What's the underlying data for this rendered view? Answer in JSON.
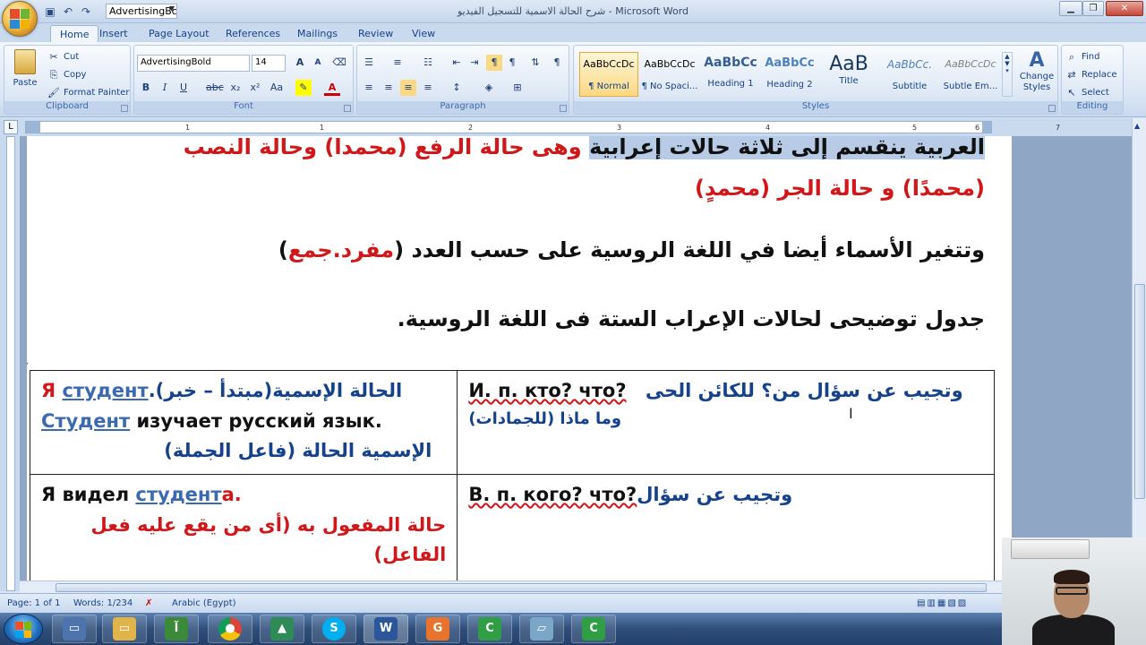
{
  "titlebar": {
    "window_title": "شرح الحالة الاسمية للتسجيل الفيديو - Microsoft Word",
    "font_combo_value": "AdvertisingBc"
  },
  "tabs": [
    "Home",
    "Insert",
    "Page Layout",
    "References",
    "Mailings",
    "Review",
    "View"
  ],
  "active_tab": "Home",
  "ribbon": {
    "clipboard": {
      "label": "Clipboard",
      "paste": "Paste",
      "cut": "Cut",
      "copy": "Copy",
      "format_painter": "Format Painter"
    },
    "font": {
      "label": "Font",
      "font_name": "AdvertisingBold",
      "font_size": "14"
    },
    "paragraph": {
      "label": "Paragraph"
    },
    "styles": {
      "label": "Styles",
      "items": [
        {
          "preview": "AaBbCcDc",
          "name": "¶ Normal"
        },
        {
          "preview": "AaBbCcDc",
          "name": "¶ No Spaci..."
        },
        {
          "preview": "AaBbCc",
          "name": "Heading 1"
        },
        {
          "preview": "AaBbCc",
          "name": "Heading 2"
        },
        {
          "preview": "AaB",
          "name": "Title"
        },
        {
          "preview": "AaBbCc.",
          "name": "Subtitle"
        },
        {
          "preview": "AaBbCcDc",
          "name": "Subtle Em..."
        }
      ],
      "change_styles": "Change Styles"
    },
    "editing": {
      "label": "Editing",
      "find": "Find",
      "replace": "Replace",
      "select": "Select"
    }
  },
  "ruler": {
    "numbers": [
      "1",
      "1",
      "2",
      "3",
      "4",
      "5",
      "6",
      "7"
    ]
  },
  "document": {
    "line1_black": "العربية ينقسم إلى ثلاثة حالات إعرابية",
    "line1_red": "وهى حالة الرفع (محمدا) وحالة النصب",
    "line2_red": "(محمدًا) و حالة الجر (محمدٍ)",
    "line3_black": "وتتغير الأسماء أيضا في اللغة الروسية على حسب العدد (",
    "line3_red": "مفرد.جمع",
    "line3_close": ")",
    "line4": "جدول توضيحى لحالات الإعراب الستة فى اللغة الروسية.",
    "table": {
      "row1_left_ru1_prefix": "Я",
      "row1_left_ru1_link": "студент",
      "row1_left_ar1": ".(مبتدأ – خبر)الحالة الإسمية",
      "row1_left_ru2_link": "Студент",
      "row1_left_ru2_rest": "изучает русский язык.",
      "row1_left_ar2": "الإسمية الحالة (فاعل الجملة)",
      "row1_right_ru": "И. п. кто? что?",
      "row1_right_ar1": "وتجيب عن سؤال من؟ للكائن الحى",
      "row1_right_ar2": "وما ماذا (للجمادات)",
      "row2_left_ru_prefix": "Я видел",
      "row2_left_ru_link": "студент",
      "row2_left_ru_suffix": "а.",
      "row2_left_ar1": "حالة المفعول به (أى من يقع عليه فعل",
      "row2_left_ar2": "الفاعل)",
      "row2_right_ru": "В. п. кого? что?",
      "row2_right_ar": "وتجيب عن سؤال"
    }
  },
  "statusbar": {
    "page": "Page: 1 of 1",
    "words": "Words: 1/234",
    "language": "Arabic (Egypt)"
  },
  "colors": {
    "accent_red": "#d0181b",
    "link_blue": "#3b6ab0",
    "ribbon_bg": "#dbe6f4"
  }
}
